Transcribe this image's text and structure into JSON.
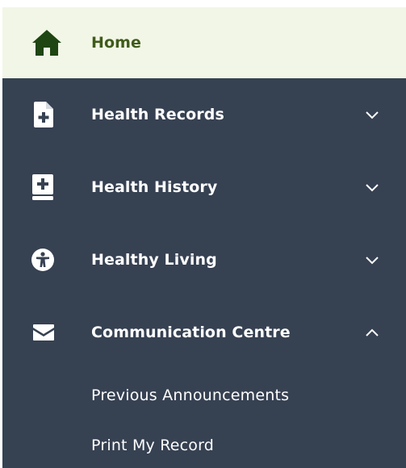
{
  "menu": {
    "items": [
      {
        "label": "Home",
        "icon": "home-icon",
        "state": "active"
      },
      {
        "label": "Health Records",
        "icon": "document-plus-icon",
        "state": "collapsed"
      },
      {
        "label": "Health History",
        "icon": "medical-book-icon",
        "state": "collapsed"
      },
      {
        "label": "Healthy Living",
        "icon": "accessibility-icon",
        "state": "collapsed"
      },
      {
        "label": "Communication Centre",
        "icon": "envelope-icon",
        "state": "expanded"
      }
    ],
    "subitems": [
      {
        "label": "Previous Announcements"
      },
      {
        "label": "Print My Record"
      }
    ]
  },
  "colors": {
    "sidebar_bg": "#364152",
    "active_bg": "#f2f6e6",
    "active_text": "#3f5b1b",
    "active_icon": "#1e4512",
    "text": "#ffffff"
  }
}
